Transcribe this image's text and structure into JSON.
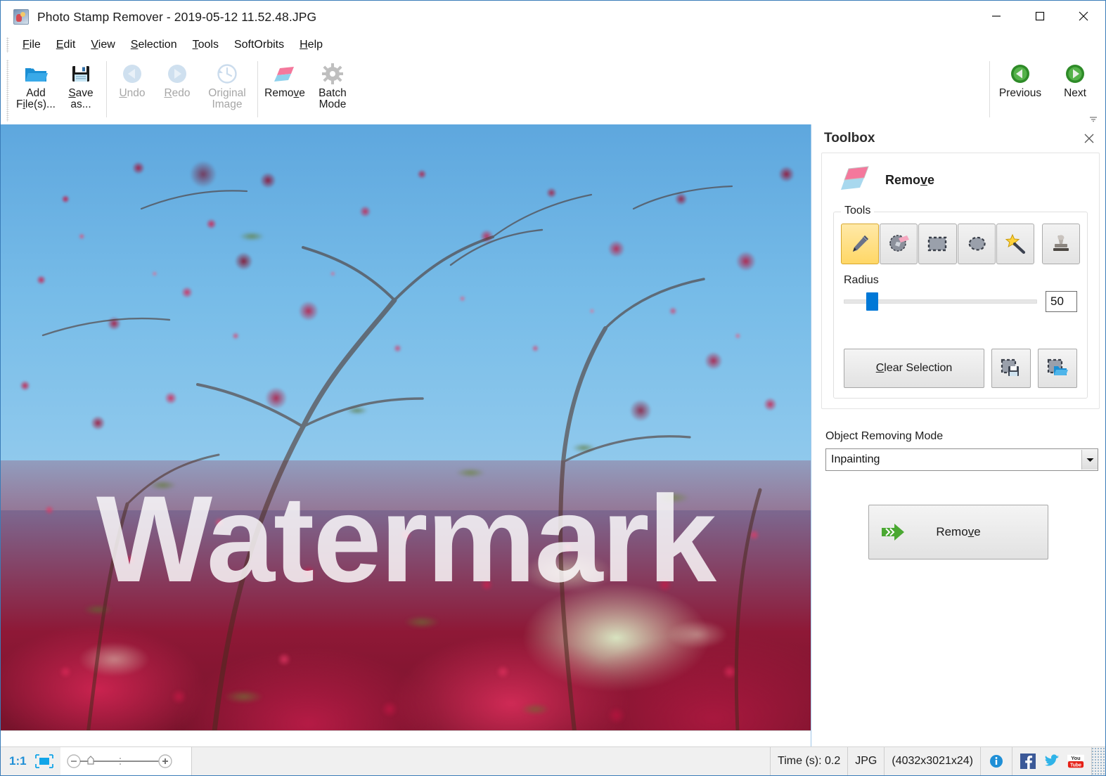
{
  "window": {
    "title": "Photo Stamp Remover - 2019-05-12 11.52.48.JPG",
    "app_icon": "photo-stamp-remover-icon",
    "minimize": "minimize-icon",
    "maximize": "maximize-icon",
    "close": "close-icon"
  },
  "menu": {
    "items": [
      {
        "label": "File",
        "accel": "F"
      },
      {
        "label": "Edit",
        "accel": "E"
      },
      {
        "label": "View",
        "accel": "V"
      },
      {
        "label": "Selection",
        "accel": "S"
      },
      {
        "label": "Tools",
        "accel": "T"
      },
      {
        "label": "SoftOrbits",
        "accel": ""
      },
      {
        "label": "Help",
        "accel": "H"
      }
    ]
  },
  "toolbar": {
    "add_files_line1": "Add",
    "add_files_line2": "File(s)...",
    "save_as_line1": "Save",
    "save_as_line2": "as...",
    "undo": "Undo",
    "redo": "Redo",
    "original_image_line1": "Original",
    "original_image_line2": "Image",
    "remove": "Remove",
    "batch_mode_line1": "Batch",
    "batch_mode_line2": "Mode",
    "previous": "Previous",
    "next": "Next"
  },
  "canvas": {
    "watermark_text": "Watermark",
    "image_description": "Pink crabapple blossoms against blue sky"
  },
  "toolbox": {
    "panel_title": "Toolbox",
    "section_title": "Remove",
    "tools_group_label": "Tools",
    "tools": [
      {
        "name": "pencil-tool",
        "label": "Pencil",
        "selected": true
      },
      {
        "name": "eraser-tool",
        "label": "Eraser",
        "selected": false
      },
      {
        "name": "rectangle-select-tool",
        "label": "Rectangle Selection",
        "selected": false
      },
      {
        "name": "lasso-select-tool",
        "label": "Lasso Selection",
        "selected": false
      },
      {
        "name": "magic-wand-tool",
        "label": "Magic Wand",
        "selected": false
      },
      {
        "name": "stamp-tool",
        "label": "Stamp",
        "selected": false
      }
    ],
    "radius_label": "Radius",
    "radius_value": "50",
    "radius_percent": 11.5,
    "clear_selection": "Clear Selection",
    "save_selection_icon": "save-selection-icon",
    "load_selection_icon": "load-selection-icon",
    "mode_label": "Object Removing Mode",
    "mode_value": "Inpainting",
    "mode_options": [
      "Inpainting"
    ],
    "remove_button": "Remove"
  },
  "statusbar": {
    "zoom_ratio": "1:1",
    "fit_icon": "fit-to-window-icon",
    "time": "Time (s): 0.2",
    "format": "JPG",
    "dimensions": "(4032x3021x24)",
    "info_icon": "info-icon",
    "facebook_icon": "facebook-icon",
    "twitter_icon": "twitter-icon",
    "youtube_icon": "youtube-icon"
  },
  "colors": {
    "accent": "#0078d7",
    "window_border": "#3a7cb8",
    "selected_tool": "#ffd766",
    "green_nav": "#3f9c35",
    "sky": "#72b5e0",
    "blossom": "#c4184a"
  }
}
